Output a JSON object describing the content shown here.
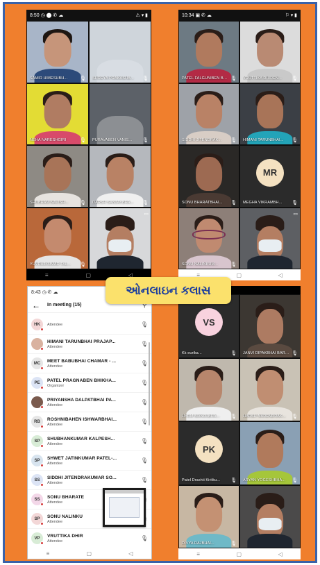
{
  "banner": {
    "text": "ઓનલાઇન કલાસ"
  },
  "phone_tl": {
    "status_time": "8:50",
    "status_left_icons": "◷ ⬤ ✆ ☁",
    "status_right": "⚠ ▾ ▮",
    "tiles": [
      {
        "name": "SAMIR HIMESHBH...",
        "mic": "🎙"
      },
      {
        "name": "SHREYA PRAKASHB...",
        "mic": "🎙"
      },
      {
        "name": "NEHA NARESHGIRI",
        "mic": "🎙"
      },
      {
        "name": "PURAVABEN VANIS...",
        "mic": "🎙"
      },
      {
        "name": "SHUBHAM NAVISH...",
        "mic": "🎙"
      },
      {
        "name": "DARSH SANJAYBHA...",
        "mic": "🎙"
      },
      {
        "name": "YUVRAJKUMAR TAL...",
        "mic": "🎙"
      },
      {
        "name": "",
        "mic": ""
      }
    ],
    "nav": [
      "≡",
      "▢",
      "◁"
    ]
  },
  "phone_tr": {
    "status_time": "10:34",
    "status_left_icons": "▣ ✆ ☁",
    "status_right": "⚐ ▾ ▮",
    "tiles": [
      {
        "name": "PATEL FALGUNIBEN BHI...",
        "mic": "🎙"
      },
      {
        "name": "VRUTTIKA DHIREN...",
        "mic": "🎙"
      },
      {
        "name": "SIDDHI JITENDRAK...",
        "mic": "🎙"
      },
      {
        "name": "HIMANI TARUNBHAI...",
        "mic": "🎙"
      },
      {
        "name": "SONU BHARATBHAI...",
        "mic": "🎙"
      },
      {
        "name": "MEGHA VIKRAMBH...",
        "mic": "🎙",
        "initials": "MR"
      },
      {
        "name": "SONU NALINKUM...",
        "mic": "🎙"
      },
      {
        "name": "",
        "mic": ""
      }
    ],
    "nav": [
      "≡",
      "▢",
      "◁"
    ]
  },
  "phone_br": {
    "tiles": [
      {
        "name": "Kk eurika...",
        "mic": "🎙",
        "initials": "VS"
      },
      {
        "name": "JANVI DIPAKBHAI BARO...",
        "mic": "🎙"
      },
      {
        "name": "HYDM MANOJBHA...",
        "mic": "🎙"
      },
      {
        "name": "HARSH NARENDRAK...",
        "mic": "🎙"
      },
      {
        "name": "Patel Drashti Kiritku...",
        "mic": "🎙",
        "initials": "PK"
      },
      {
        "name": "ARYAN YOGESHBHA...",
        "mic": "🎙"
      },
      {
        "name": "DIVYA RAJBHAI...",
        "mic": "🎙"
      },
      {
        "name": "",
        "mic": ""
      }
    ],
    "nav": [
      "≡",
      "▢",
      "◁"
    ]
  },
  "list_phone": {
    "status_time": "8:43",
    "status_left_icons": "◷ ✆ ☁",
    "status_right": "⚠ ▾ ▮",
    "back_icon": "←",
    "title": "In meeting (15)",
    "search_icon": "⚲",
    "participants": [
      {
        "initials": "HK",
        "name": "",
        "role": "Attendee",
        "avatar_color": "#f3d7d7",
        "mic": "🎙"
      },
      {
        "initials": "",
        "name": "HIMANI TARUNBHAI PRAJAP...",
        "role": "Attendee",
        "avatar_color": "#d9b2a0",
        "mic": "🎙"
      },
      {
        "initials": "MC",
        "name": "MEET BABUBHAI CHAMAR - ...",
        "role": "Attendee",
        "avatar_color": "#e6e6e6",
        "mic": "🎙"
      },
      {
        "initials": "PE",
        "name": "PATEL PRAGNABEN BHIKHA...",
        "role": "Organizer",
        "avatar_color": "#dce4f5",
        "mic": "🎙"
      },
      {
        "initials": "",
        "name": "PRIYANSHA DALPATBHAI PA...",
        "role": "Attendee",
        "avatar_color": "#7a5a4d",
        "mic": "🎙"
      },
      {
        "initials": "RB",
        "name": "ROSHNIBAHEN ISHWARBHAI...",
        "role": "Attendee",
        "avatar_color": "#e6e6e6",
        "mic": "🎙"
      },
      {
        "initials": "SP",
        "name": "SHUBHANKUMAR KALPESH...",
        "role": "Attendee",
        "avatar_color": "#d8ecd6",
        "mic": "🎙"
      },
      {
        "initials": "SP",
        "name": "SHWET JATINKUMAR PATEL-...",
        "role": "Attendee",
        "avatar_color": "#d8e4ef",
        "mic": "🎙"
      },
      {
        "initials": "SS",
        "name": "SIDDHI JITENDRAKUMAR SO...",
        "role": "Attendee",
        "avatar_color": "#dce4f5",
        "mic": "🎙"
      },
      {
        "initials": "SS",
        "name": "SONU BHARATE",
        "role": "Attendee",
        "avatar_color": "#f3d7e8",
        "mic": "🎙"
      },
      {
        "initials": "SP",
        "name": "SONU NALINKU",
        "role": "Attendee",
        "avatar_color": "#f3d7d7",
        "mic": "🎙"
      },
      {
        "initials": "VP",
        "name": "VRUTTIKA DHIR",
        "role": "Attendee",
        "avatar_color": "#d8ecd6",
        "mic": "🎙"
      }
    ],
    "nav": [
      "≡",
      "▢",
      "◁"
    ]
  },
  "colors": {
    "background": "#f07f2d",
    "border": "#3a62a8",
    "banner_bg": "#fbe16c",
    "banner_text": "#1c3e9e"
  }
}
